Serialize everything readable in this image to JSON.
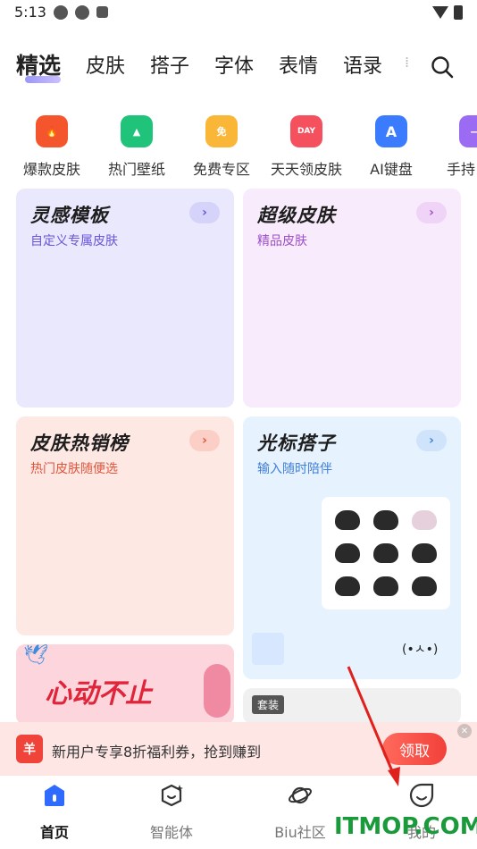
{
  "status_bar": {
    "time": "5:13"
  },
  "top_tabs": [
    "精选",
    "皮肤",
    "搭子",
    "字体",
    "表情",
    "语录"
  ],
  "shortcuts": [
    {
      "label": "爆款皮肤",
      "icon": "tshirt-fire-icon",
      "color": "#f5552d"
    },
    {
      "label": "热门壁纸",
      "icon": "wallpaper-icon",
      "color": "#1fc37a"
    },
    {
      "label": "免费专区",
      "icon": "free-tshirt-icon",
      "color": "#f9b637",
      "glyph": "免"
    },
    {
      "label": "天天领皮肤",
      "icon": "day-tshirt-icon",
      "color": "#f5505d",
      "glyph": "DAY"
    },
    {
      "label": "AI键盘",
      "icon": "ai-icon",
      "color": "#3b7cff",
      "glyph": "A"
    },
    {
      "label": "手持",
      "icon": "handheld-icon",
      "color": "#9b6cf3"
    }
  ],
  "cards": {
    "inspiration": {
      "title": "灵感模板",
      "subtitle": "自定义专属皮肤",
      "bg": "#e9e8fd"
    },
    "super_skin": {
      "title": "超级皮肤",
      "subtitle": "精品皮肤",
      "bg": "#f8ecfc"
    },
    "hot_skin": {
      "title": "皮肤热销榜",
      "subtitle": "热门皮肤随便选",
      "bg": "#fde8e4"
    },
    "cursor_buddy": {
      "title": "光标搭子",
      "subtitle": "输入随时陪伴",
      "bg": "#e6f2fd",
      "emoticon": "(•ㅅ•)"
    },
    "banner": {
      "title": "心动不止"
    },
    "set": {
      "tag": "套装"
    }
  },
  "promo": {
    "icon_glyph": "羊",
    "text": "新用户专享8折福利券，抢到赚到",
    "button": "领取"
  },
  "bottom_nav": [
    {
      "label": "首页",
      "icon": "home-icon"
    },
    {
      "label": "智能体",
      "icon": "agent-icon"
    },
    {
      "label": "Biu社区",
      "icon": "planet-icon"
    },
    {
      "label": "我的",
      "icon": "profile-icon"
    }
  ],
  "watermark": "ITMOP.COM"
}
